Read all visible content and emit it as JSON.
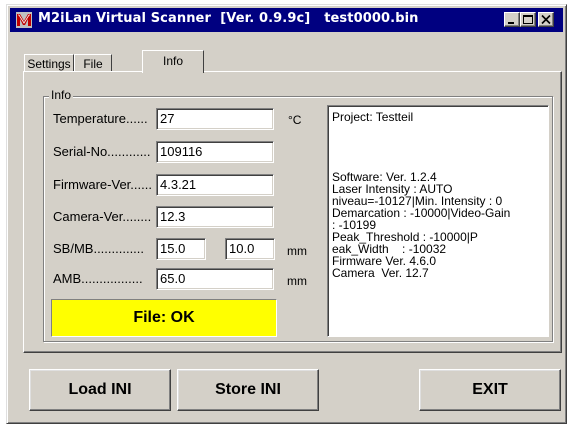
{
  "window": {
    "title": "M2iLan Virtual Scanner  [Ver. 0.9.9c]   test0000.bin",
    "icon": "m2ilan-app-icon",
    "controls": [
      "minimize",
      "maximize",
      "close"
    ]
  },
  "tabs": [
    {
      "label": "Settings",
      "active": false
    },
    {
      "label": "File",
      "active": false
    },
    {
      "label": "Info",
      "active": true
    }
  ],
  "info_group": {
    "label": "Info",
    "fields": {
      "temperature": {
        "label": "Temperature......",
        "value": "27",
        "unit": "°C"
      },
      "serial": {
        "label": "Serial-No............",
        "value": "109116"
      },
      "firmware": {
        "label": "Firmware-Ver......",
        "value": "4.3.21"
      },
      "camera": {
        "label": "Camera-Ver........",
        "value": "12.3"
      },
      "sbmb": {
        "label": "SB/MB..............",
        "value1": "15.0",
        "value2": "10.0",
        "unit": "mm"
      },
      "amb": {
        "label": "AMB.................",
        "value": "65.0",
        "unit": "mm"
      }
    },
    "status": "File: OK",
    "info_lines": [
      "Project: Testteil",
      "",
      "",
      "",
      "",
      "Software: Ver. 1.2.4",
      "Laser Intensity : AUTO",
      "niveau=-10127|Min. Intensity : 0",
      "Demarcation : -10000|Video-Gain",
      ": -10199",
      "Peak_Threshold : -10000|P",
      "eak_Width    : -10032",
      "Firmware Ver. 4.6.0",
      "Camera  Ver. 12.7"
    ]
  },
  "buttons": {
    "load": "Load INI",
    "store": "Store INI",
    "exit": "EXIT"
  },
  "colors": {
    "titlebar": "#000080",
    "face": "#d4d0c8",
    "status_bg": "#ffff00"
  }
}
